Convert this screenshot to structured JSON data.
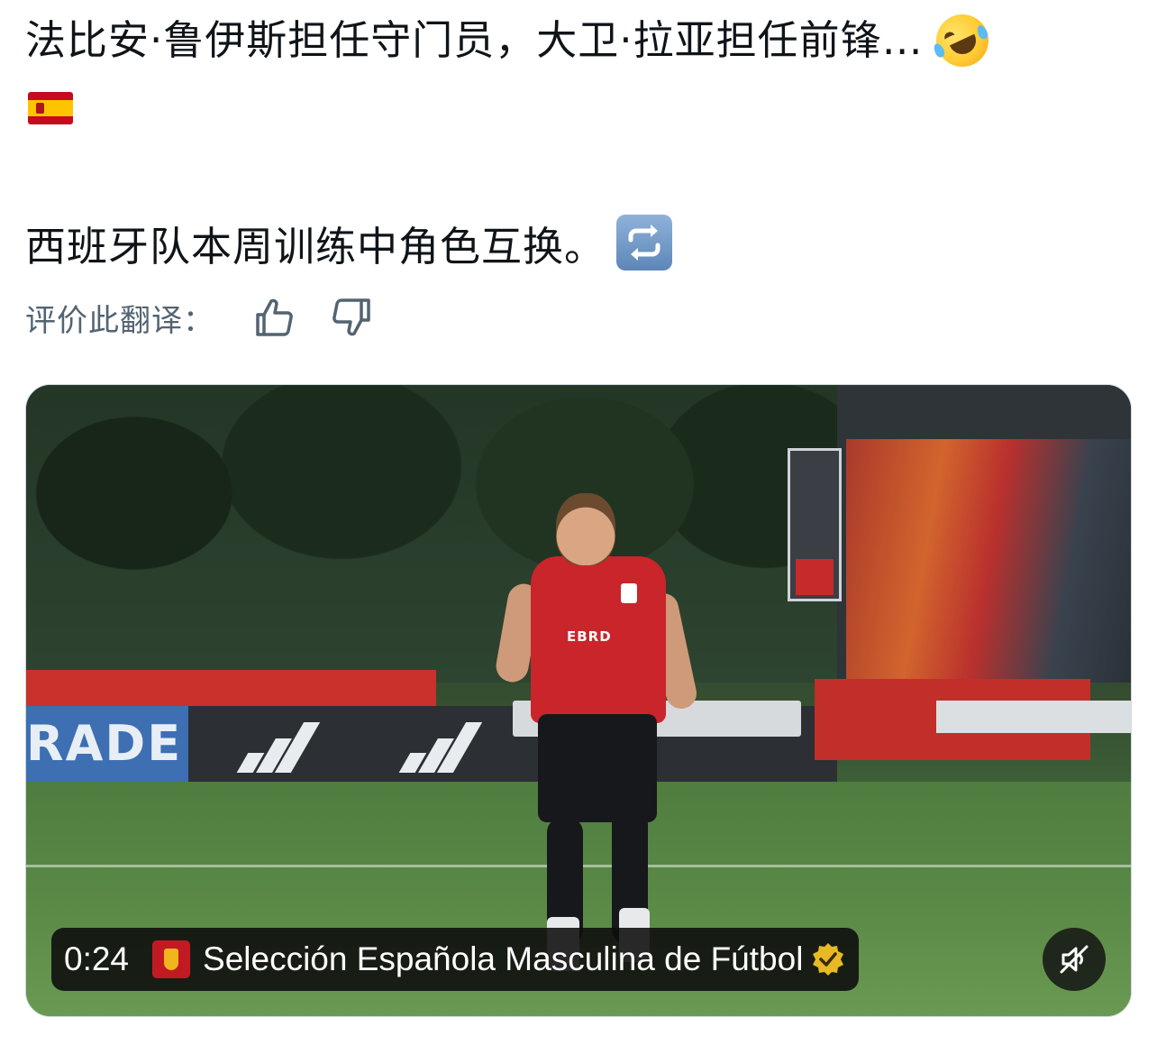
{
  "post": {
    "line1_text": "法比安·鲁伊斯担任守门员，大卫·拉亚担任前锋…",
    "line1_emoji": "rolling-on-the-floor-laughing-emoji",
    "line2_emoji": "spain-flag-emoji",
    "line3_text": "西班牙队本周训练中角色互换。",
    "line3_emoji": "repeat-button-emoji"
  },
  "rating": {
    "label": "评价此翻译：",
    "up_icon": "thumbs-up-icon",
    "down_icon": "thumbs-down-icon"
  },
  "video": {
    "time": "0:24",
    "channel_name": "Selección Española Masculina de Fútbol",
    "channel_icon": "rfef-crest-icon",
    "verified_icon": "verified-badge-icon",
    "mute_icon": "speaker-muted-icon",
    "board_text": "RADE",
    "shirt_brand": "EBRD",
    "colors": {
      "overlay": "#0c0c0c",
      "verified": "#e8b923",
      "shirt": "#c9252b"
    }
  }
}
